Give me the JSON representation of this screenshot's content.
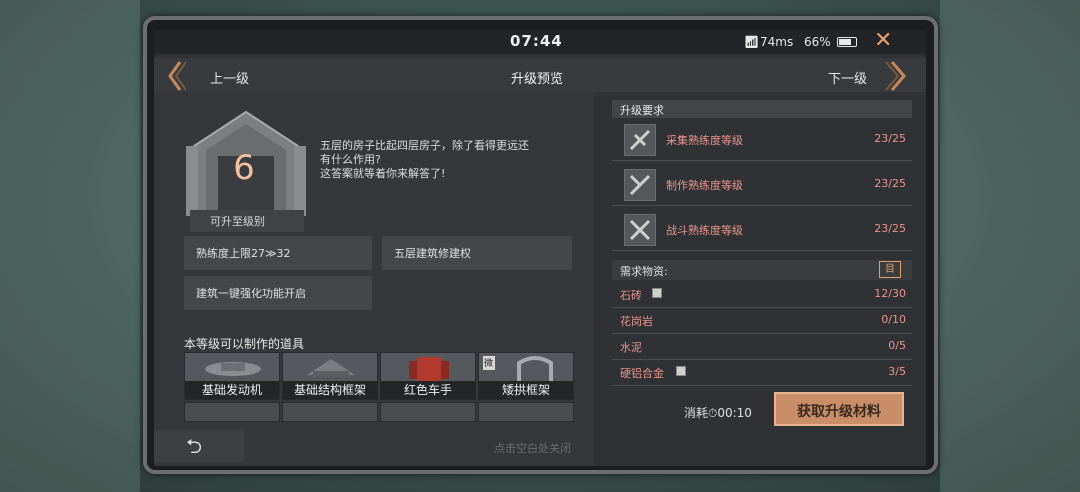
{
  "status": {
    "clock": "07:44",
    "ping": "74ms",
    "battery": "66%"
  },
  "nav": {
    "prev": "上一级",
    "title": "升级预览",
    "next": "下一级"
  },
  "building": {
    "level": "6",
    "caption": "可升至级别",
    "description": [
      "五层的房子比起四层房子，除了看得更远还",
      "有什么作用?",
      "这答案就等着你来解答了!"
    ]
  },
  "perks": [
    "熟练度上限27≫32",
    "五层建筑修建权",
    "建筑一键强化功能开启"
  ],
  "craft": {
    "title": "本等级可以制作的道具",
    "items": [
      "基础发动机",
      "基础结构框架",
      "红色车手",
      "矮拱框架"
    ],
    "tag": "微"
  },
  "requirements": {
    "title": "升级要求",
    "items": [
      {
        "name": "采集熟练度等级",
        "value": "23/25"
      },
      {
        "name": "制作熟练度等级",
        "value": "23/25"
      },
      {
        "name": "战斗熟练度等级",
        "value": "23/25"
      }
    ]
  },
  "materials": {
    "title": "需求物资:",
    "items": [
      {
        "name": "石砖",
        "value": "12/30"
      },
      {
        "name": "花岗岩",
        "value": "0/10"
      },
      {
        "name": "水泥",
        "value": "0/5"
      },
      {
        "name": "硬铝合金",
        "value": "3/5"
      }
    ]
  },
  "footer": {
    "consume": "消耗⏱00:10",
    "get_button": "获取升级材料",
    "hint": "点击空白处关闭"
  },
  "colors": {
    "accent": "#e3a069",
    "requirement_text": "#e8958c"
  }
}
